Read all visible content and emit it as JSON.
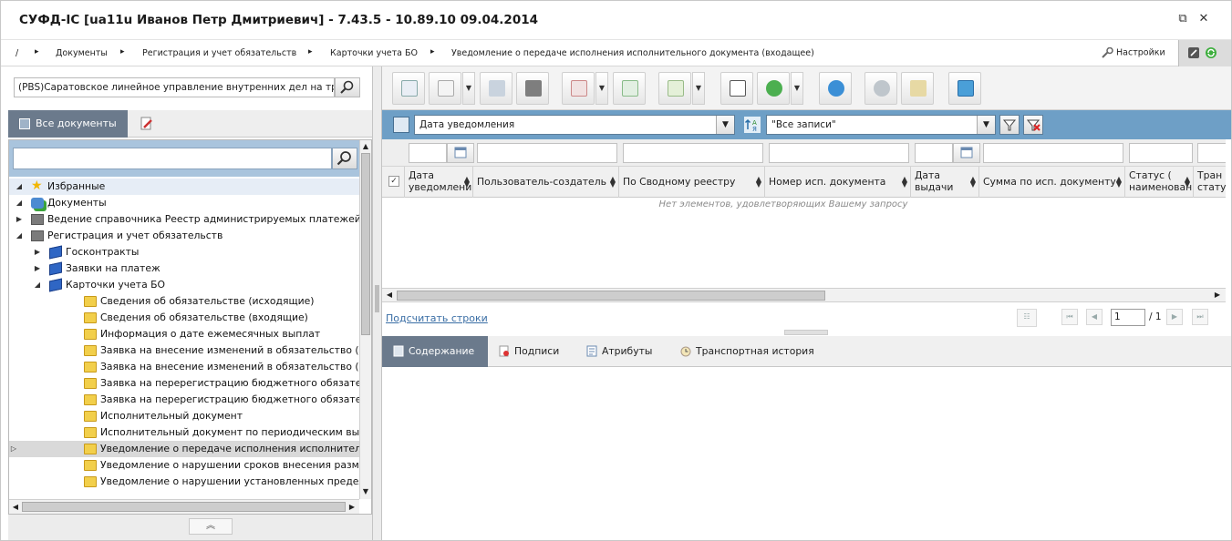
{
  "window": {
    "title": "СУФД-IC [ua11u Иванов Петр Дмитриевич] - 7.43.5 - 10.89.10 09.04.2014",
    "restore_icon": "restore-icon",
    "close_icon": "close-icon"
  },
  "breadcrumb": {
    "root": "/",
    "items": [
      "Документы",
      "Регистрация и учет обязательств",
      "Карточки учета БО",
      "Уведомление о передаче исполнения исполнительного документа (входащее)"
    ],
    "settings_label": "Настройки"
  },
  "left_panel": {
    "org_value": "(PBS)Саратовское линейное управление внутренних дел на трансп",
    "tab_all_docs": "Все документы",
    "tree": [
      {
        "label": "Избранные",
        "icon": "star-icon",
        "level": 0,
        "expanded": true
      },
      {
        "label": "Документы",
        "icon": "documents-icon",
        "level": 0,
        "expanded": true
      },
      {
        "label": "Ведение справочника Реестр администрируемых платежей",
        "icon": "box-icon",
        "level": 1,
        "expanded": false
      },
      {
        "label": "Регистрация и учет обязательств",
        "icon": "box-icon",
        "level": 1,
        "expanded": true
      },
      {
        "label": "Госконтракты",
        "icon": "book-icon",
        "level": 2,
        "expanded": false
      },
      {
        "label": "Заявки на платеж",
        "icon": "book-icon",
        "level": 2,
        "expanded": false
      },
      {
        "label": "Карточки учета БО",
        "icon": "book-icon",
        "level": 2,
        "expanded": true
      },
      {
        "label": "Сведения об обязательстве (исходящие)",
        "icon": "folder-icon",
        "level": 3
      },
      {
        "label": "Сведения об обязательстве (входящие)",
        "icon": "folder-icon",
        "level": 3
      },
      {
        "label": "Информация о дате ежемесячных выплат",
        "icon": "folder-icon",
        "level": 3
      },
      {
        "label": "Заявка на внесение изменений в обязательство (исхо",
        "icon": "folder-icon",
        "level": 3
      },
      {
        "label": "Заявка на внесение изменений в обязательство (вход",
        "icon": "folder-icon",
        "level": 3
      },
      {
        "label": "Заявка на перерегистрацию бюджетного обязательств",
        "icon": "folder-icon",
        "level": 3
      },
      {
        "label": "Заявка на перерегистрацию бюджетного обязательств",
        "icon": "folder-icon",
        "level": 3
      },
      {
        "label": "Исполнительный документ",
        "icon": "folder-icon",
        "level": 3
      },
      {
        "label": "Исполнительный документ по периодическим выплата",
        "icon": "folder-icon",
        "level": 3
      },
      {
        "label": "Уведомление о передаче исполнения исполнительного",
        "icon": "folder-icon",
        "level": 3,
        "selected": true
      },
      {
        "label": "Уведомление о нарушении сроков внесения размеров",
        "icon": "folder-icon",
        "level": 3
      },
      {
        "label": "Уведомление о нарушении установленных предельных",
        "icon": "folder-icon",
        "level": 3
      }
    ],
    "collapse_label": "︽"
  },
  "toolbar": {
    "buttons": [
      "view-icon",
      "delete-icon",
      "copy-icon",
      "print-icon",
      "sign-icon",
      "check-sign-icon",
      "export-icon",
      "find-icon",
      "download-icon",
      "refresh-icon",
      "settings-icon",
      "archive-icon",
      "exit-icon"
    ]
  },
  "filter": {
    "date_field": "Дата уведомления",
    "records_filter": "\"Все записи\""
  },
  "grid": {
    "columns": [
      "Дата уведомлени",
      "Пользователь-создатель",
      "По Сводному реестру",
      "Номер исп. документа",
      "Дата выдачи",
      "Сумма по исп. документу",
      "Статус ( наименован",
      "Тран статус"
    ],
    "empty_message": "Нет элементов, удовлетворяющих Вашему запросу"
  },
  "pager": {
    "count_rows_link": "Подсчитать строки",
    "page": "1",
    "total": "/ 1"
  },
  "detail_tabs": [
    "Содержание",
    "Подписи",
    "Атрибуты",
    "Транспортная история"
  ],
  "colors": {
    "accent_blue": "#6e9fc6",
    "tab_active": "#6b7a8c",
    "link": "#3a6ea5"
  }
}
